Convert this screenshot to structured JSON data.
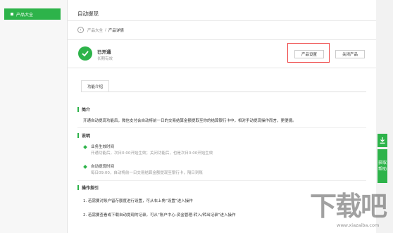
{
  "sidebar": {
    "items": [
      {
        "label": "产品大全"
      }
    ]
  },
  "header": {
    "title": "自动提现",
    "breadcrumb": {
      "parent": "产品大全",
      "separator": "/",
      "current": "产品详情"
    }
  },
  "status": {
    "title": "已开通",
    "subtitle": "长期有效"
  },
  "actions": {
    "settings_label": "产品设置",
    "close_label": "关闭产品"
  },
  "tabs": [
    {
      "label": "功能介绍"
    }
  ],
  "sections": {
    "intro": {
      "title": "简介",
      "text": "开通自动提现功能后，微信支付会自动将前一日的交易结算金额提取至你的结算银行卡中，相对手动提现操作而言，更便捷。"
    },
    "notes": {
      "title": "说明",
      "items": [
        {
          "title": "业务生效时间",
          "desc": "开通功能后，次日0:00开始生效；关闭功能后，也是次日0:00开始生效"
        },
        {
          "title": "自动提现时间",
          "desc": "每日09:00，自动将前一日交易结算金额提现至银行卡，隔日到账"
        }
      ]
    },
    "guide": {
      "title": "操作指引",
      "steps": [
        "1. 若需要对账户留存额度进行设置，可从右上角“设置”进入操作",
        "2. 若需要查看或下载自动提现的记录，可从“账户中心-资金管理-转入/转出记录”进入操作"
      ]
    }
  },
  "float_panel": {
    "help_label_1": "获取",
    "help_label_2": "帮助"
  },
  "watermark": {
    "brand": "下载吧",
    "url": "www.xiazaiba.com"
  },
  "colors": {
    "accent": "#2db34a",
    "highlight": "#e44444"
  }
}
